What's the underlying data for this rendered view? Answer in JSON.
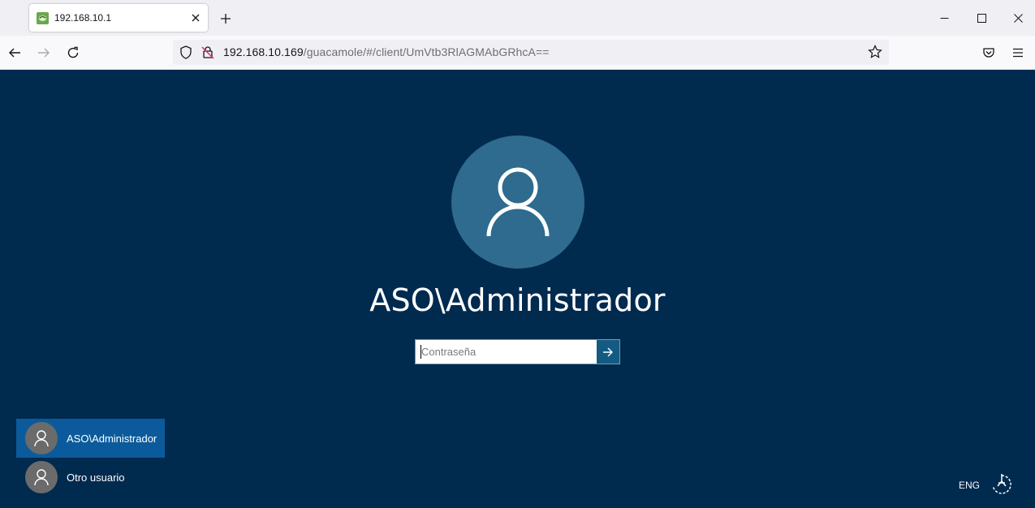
{
  "browser": {
    "tab": {
      "title": "192.168.10.1"
    },
    "url": {
      "host": "192.168.10.169",
      "path": "/guacamole/#/client/UmVtb3RlAGMAbGRhcA=="
    }
  },
  "lockscreen": {
    "username": "ASO\\Administrador",
    "password": {
      "placeholder": "Contraseña",
      "value": ""
    },
    "users": [
      {
        "label": "ASO\\Administrador",
        "selected": true
      },
      {
        "label": "Otro usuario",
        "selected": false
      }
    ],
    "language": "ENG"
  },
  "colors": {
    "background": "#012a4f",
    "avatar": "#2e6b8e",
    "selected_user": "#0b5b9c",
    "submit": "#135b82"
  }
}
